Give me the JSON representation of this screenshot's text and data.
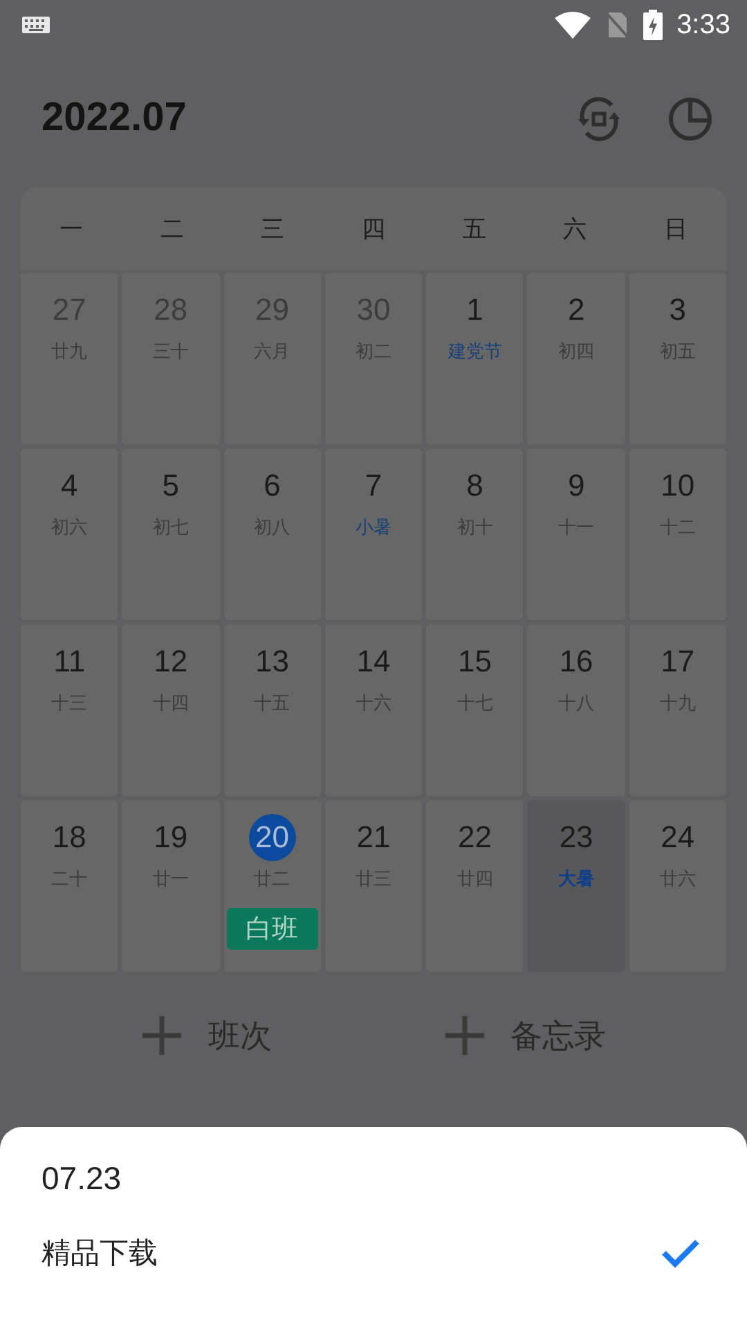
{
  "status_bar": {
    "time": "3:33"
  },
  "header": {
    "title": "2022.07"
  },
  "weekdays": [
    "一",
    "二",
    "三",
    "四",
    "五",
    "六",
    "日"
  ],
  "weeks": [
    [
      {
        "day": "27",
        "lunar": "廿九",
        "other_month": true,
        "festival": false,
        "today": false,
        "selected": false
      },
      {
        "day": "28",
        "lunar": "三十",
        "other_month": true,
        "festival": false,
        "today": false,
        "selected": false
      },
      {
        "day": "29",
        "lunar": "六月",
        "other_month": true,
        "festival": false,
        "today": false,
        "selected": false
      },
      {
        "day": "30",
        "lunar": "初二",
        "other_month": true,
        "festival": false,
        "today": false,
        "selected": false
      },
      {
        "day": "1",
        "lunar": "建党节",
        "other_month": false,
        "festival": true,
        "today": false,
        "selected": false
      },
      {
        "day": "2",
        "lunar": "初四",
        "other_month": false,
        "festival": false,
        "today": false,
        "selected": false
      },
      {
        "day": "3",
        "lunar": "初五",
        "other_month": false,
        "festival": false,
        "today": false,
        "selected": false
      }
    ],
    [
      {
        "day": "4",
        "lunar": "初六",
        "other_month": false,
        "festival": false,
        "today": false,
        "selected": false
      },
      {
        "day": "5",
        "lunar": "初七",
        "other_month": false,
        "festival": false,
        "today": false,
        "selected": false
      },
      {
        "day": "6",
        "lunar": "初八",
        "other_month": false,
        "festival": false,
        "today": false,
        "selected": false
      },
      {
        "day": "7",
        "lunar": "小暑",
        "other_month": false,
        "festival": true,
        "today": false,
        "selected": false
      },
      {
        "day": "8",
        "lunar": "初十",
        "other_month": false,
        "festival": false,
        "today": false,
        "selected": false
      },
      {
        "day": "9",
        "lunar": "十一",
        "other_month": false,
        "festival": false,
        "today": false,
        "selected": false
      },
      {
        "day": "10",
        "lunar": "十二",
        "other_month": false,
        "festival": false,
        "today": false,
        "selected": false
      }
    ],
    [
      {
        "day": "11",
        "lunar": "十三",
        "other_month": false,
        "festival": false,
        "today": false,
        "selected": false
      },
      {
        "day": "12",
        "lunar": "十四",
        "other_month": false,
        "festival": false,
        "today": false,
        "selected": false
      },
      {
        "day": "13",
        "lunar": "十五",
        "other_month": false,
        "festival": false,
        "today": false,
        "selected": false
      },
      {
        "day": "14",
        "lunar": "十六",
        "other_month": false,
        "festival": false,
        "today": false,
        "selected": false
      },
      {
        "day": "15",
        "lunar": "十七",
        "other_month": false,
        "festival": false,
        "today": false,
        "selected": false
      },
      {
        "day": "16",
        "lunar": "十八",
        "other_month": false,
        "festival": false,
        "today": false,
        "selected": false
      },
      {
        "day": "17",
        "lunar": "十九",
        "other_month": false,
        "festival": false,
        "today": false,
        "selected": false
      }
    ],
    [
      {
        "day": "18",
        "lunar": "二十",
        "other_month": false,
        "festival": false,
        "today": false,
        "selected": false
      },
      {
        "day": "19",
        "lunar": "廿一",
        "other_month": false,
        "festival": false,
        "today": false,
        "selected": false
      },
      {
        "day": "20",
        "lunar": "廿二",
        "other_month": false,
        "festival": false,
        "today": true,
        "selected": false,
        "shift": "白班"
      },
      {
        "day": "21",
        "lunar": "廿三",
        "other_month": false,
        "festival": false,
        "today": false,
        "selected": false
      },
      {
        "day": "22",
        "lunar": "廿四",
        "other_month": false,
        "festival": false,
        "today": false,
        "selected": false
      },
      {
        "day": "23",
        "lunar": "大暑",
        "other_month": false,
        "festival": true,
        "today": false,
        "selected": true
      },
      {
        "day": "24",
        "lunar": "廿六",
        "other_month": false,
        "festival": false,
        "today": false,
        "selected": false
      }
    ]
  ],
  "actions": [
    "班次",
    "备忘录"
  ],
  "sheet": {
    "title": "07.23",
    "items": [
      {
        "label": "精品下载",
        "selected": true
      }
    ]
  }
}
